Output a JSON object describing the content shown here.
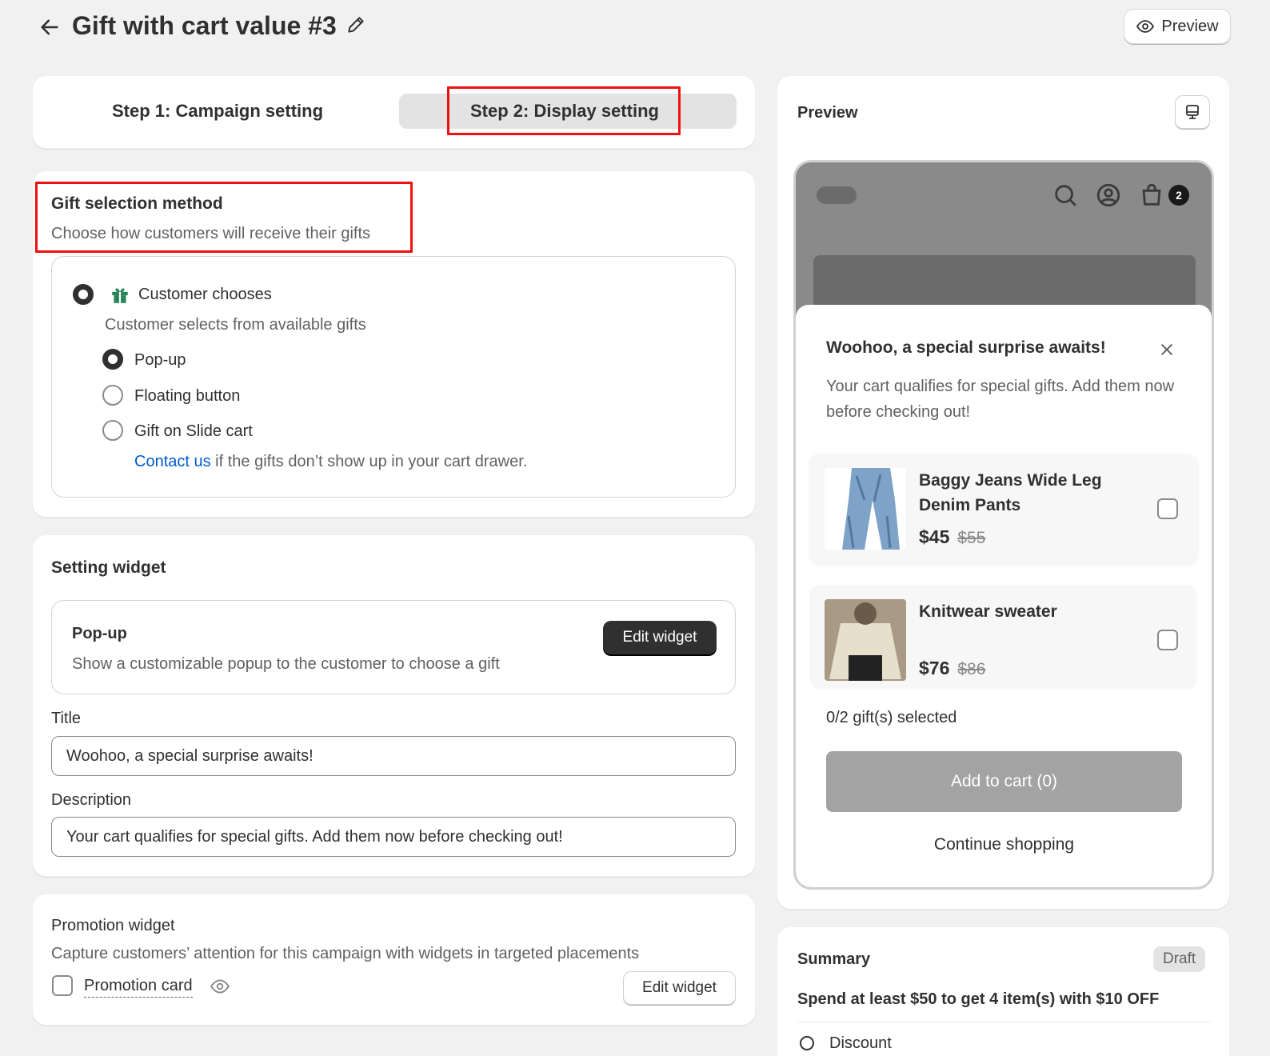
{
  "header": {
    "title": "Gift with cart value #3",
    "preview_button": "Preview"
  },
  "steps": {
    "step1": "Step 1: Campaign setting",
    "step2": "Step 2: Display setting"
  },
  "gift_selection": {
    "heading": "Gift selection method",
    "subheading": "Choose how customers will receive their gifts",
    "option_label": "Customer chooses",
    "option_desc": "Customer selects from available gifts",
    "sub_options": [
      "Pop-up",
      "Floating button",
      "Gift on Slide cart"
    ],
    "selected": "Pop-up",
    "contact_link": "Contact us",
    "contact_text": " if the gifts don’t show up in your cart drawer."
  },
  "setting_widget": {
    "heading": "Setting widget",
    "popup_title": "Pop-up",
    "popup_desc": "Show a customizable popup to the customer to choose a gift",
    "edit_button": "Edit widget",
    "title_label": "Title",
    "title_value": "Woohoo, a special surprise awaits!",
    "description_label": "Description",
    "description_value": "Your cart qualifies for special gifts. Add them now before checking out!"
  },
  "promotion_widget": {
    "heading": "Promotion widget",
    "desc": "Capture customers’ attention for this campaign with widgets in targeted placements",
    "card_label": "Promotion card",
    "edit_button": "Edit widget"
  },
  "preview_panel": {
    "heading": "Preview",
    "cart_count": "2",
    "modal_title": "Woohoo, a special surprise awaits!",
    "modal_desc": "Your cart qualifies for special gifts. Add them now before checking out!",
    "products": [
      {
        "name_line1": "Baggy Jeans Wide Leg",
        "name_line2": "Denim Pants",
        "price": "$45",
        "old_price": "$55"
      },
      {
        "name_line1": "Knitwear sweater",
        "name_line2": "",
        "price": "$76",
        "old_price": "$86"
      }
    ],
    "selected_count": "0/2 gift(s) selected",
    "add_to_cart": "Add to cart (0)",
    "continue": "Continue shopping"
  },
  "summary": {
    "heading": "Summary",
    "status": "Draft",
    "text": "Spend at least $50 to get 4 item(s) with $10 OFF",
    "discount_label": "Discount"
  },
  "colors": {
    "highlight_red": "#e11111",
    "link_blue": "#005bd3",
    "gift_green": "#29845a"
  }
}
